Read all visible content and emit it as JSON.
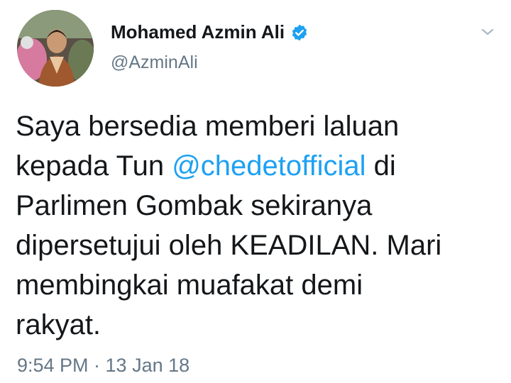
{
  "author": {
    "display_name": "Mohamed Azmin Ali",
    "handle": "@AzminAli",
    "verified": true
  },
  "tweet": {
    "lines": [
      {
        "before": "Saya bersedia memberi laluan",
        "mention": "",
        "after": ""
      },
      {
        "before": "kepada Tun ",
        "mention": "@chedetofficial",
        "after": " di"
      },
      {
        "before": "Parlimen Gombak sekiranya",
        "mention": "",
        "after": ""
      },
      {
        "before": "dipersetujui oleh KEADILAN. Mari",
        "mention": "",
        "after": ""
      },
      {
        "before": "membingkai muafakat demi",
        "mention": "",
        "after": ""
      },
      {
        "before": "rakyat.",
        "mention": "",
        "after": ""
      }
    ],
    "timestamp": "9:54 PM · 13 Jan 18"
  },
  "icons": {
    "verified": "verified-badge-icon",
    "more": "chevron-down-icon"
  },
  "colors": {
    "text": "#14171a",
    "secondary": "#657786",
    "link": "#1da1f2",
    "verified": "#1da1f2",
    "background": "#ffffff"
  }
}
